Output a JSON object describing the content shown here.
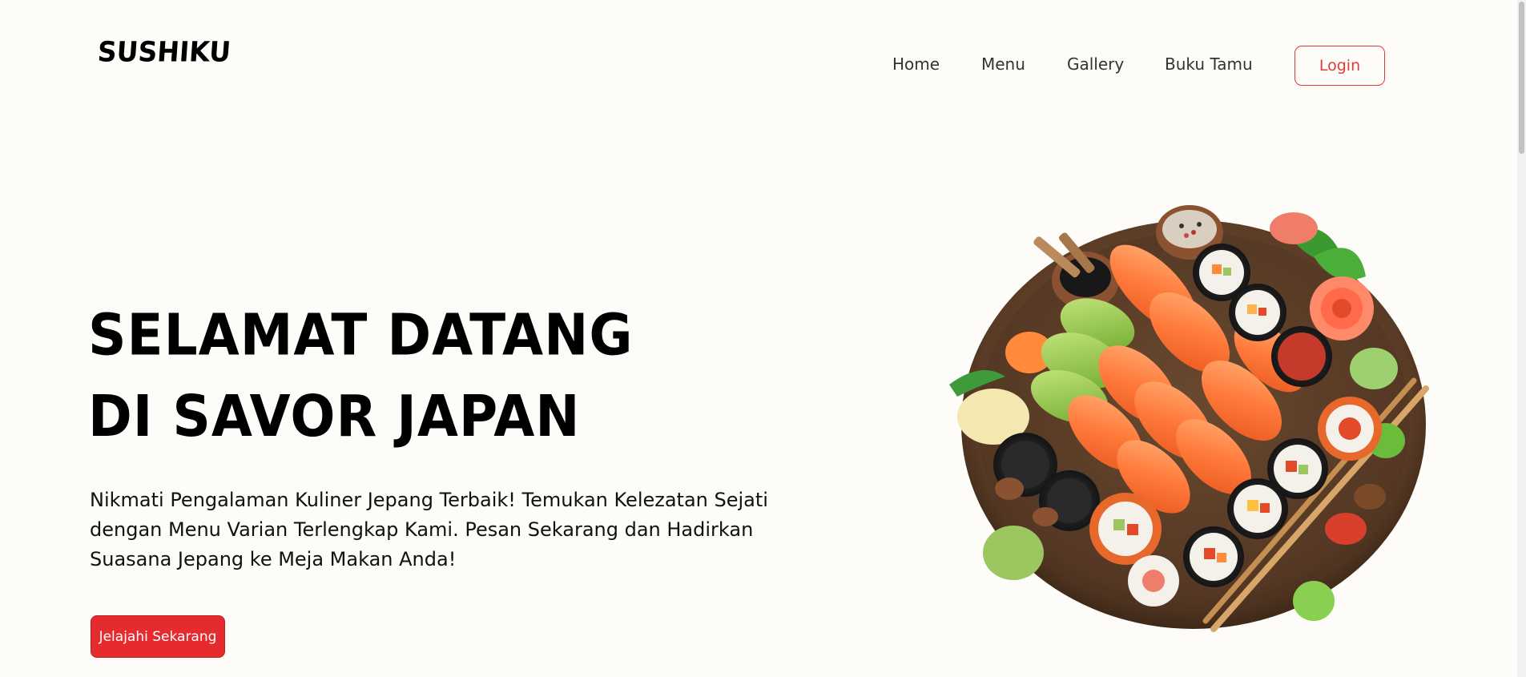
{
  "nav": {
    "logo": "SUSHIKU",
    "links": [
      "Home",
      "Menu",
      "Gallery",
      "Buku Tamu"
    ],
    "login_label": "Login"
  },
  "hero": {
    "title_line1": "SELAMAT DATANG",
    "title_line2": "DI SAVOR JAPAN",
    "description": "Nikmati Pengalaman Kuliner Jepang Terbaik! Temukan Kelezatan Sejati dengan Menu Varian Terlengkap Kami. Pesan Sekarang dan Hadirkan Suasana Jepang ke Meja Makan Anda!",
    "cta_label": "Jelajahi Sekarang",
    "image": "sushi-platter"
  },
  "colors": {
    "background": "#fdfcf8",
    "accent": "#e62b2e",
    "text": "#111111"
  }
}
